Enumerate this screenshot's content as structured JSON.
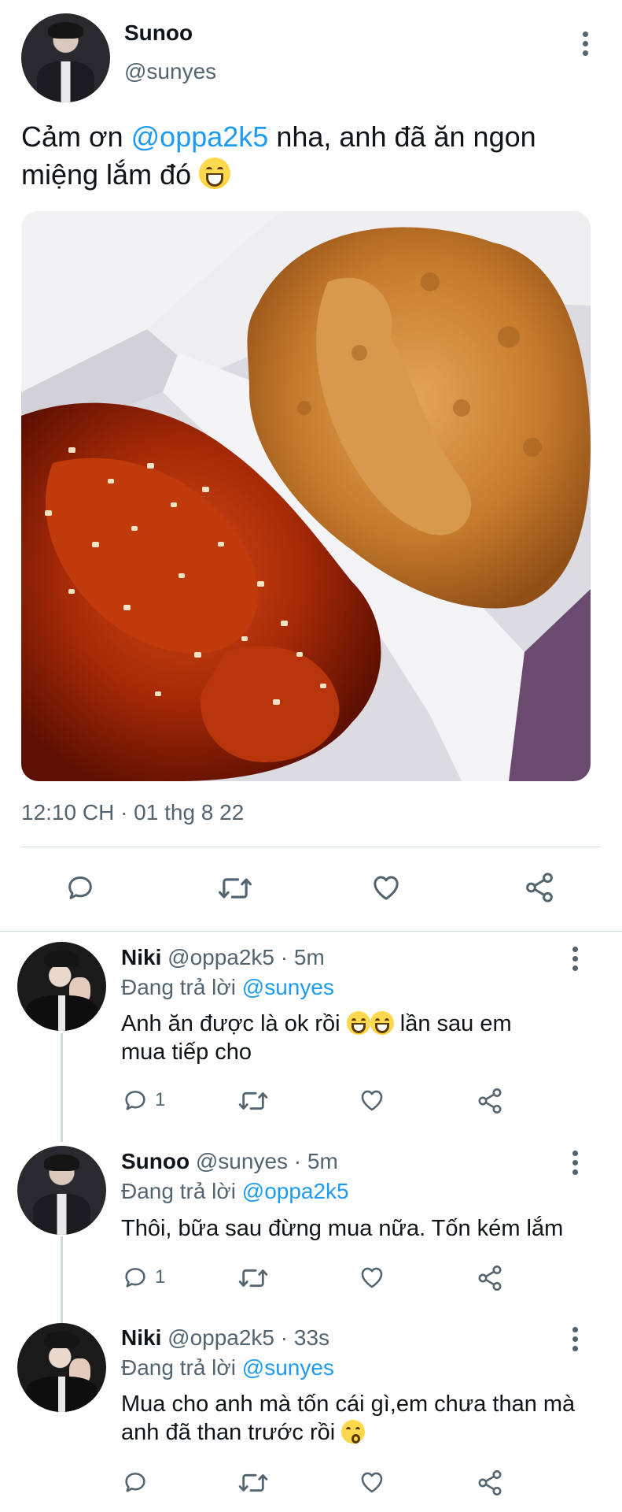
{
  "tweet": {
    "author_name": "Sunoo",
    "author_handle": "@sunyes",
    "text_before": "Cảm ơn ",
    "mention": "@oppa2k5",
    "text_after": " nha, anh đã ăn ngon miệng lắm đó",
    "emoji": "grinning-face",
    "image_alt": "fried chicken",
    "timestamp": "12:10 CH · 01 thg 8 22",
    "actions": [
      "reply-icon",
      "retweet-icon",
      "like-icon",
      "share-icon"
    ]
  },
  "replies": [
    {
      "name": "Niki",
      "handle": "@oppa2k5",
      "time": " · 5m",
      "replying_label": "Đang trả lời ",
      "replying_to": "@sunyes",
      "text_before": "Anh ăn được là ok rồi ",
      "text_after": " lần sau em mua tiếp cho",
      "reply_count": "1"
    },
    {
      "name": "Sunoo",
      "handle": "@sunyes",
      "time": " · 5m",
      "replying_label": "Đang trả lời ",
      "replying_to": "@oppa2k5",
      "text": "Thôi, bữa sau đừng mua nữa. Tốn kém lắm",
      "reply_count": "1"
    },
    {
      "name": "Niki",
      "handle": "@oppa2k5",
      "time": " · 33s",
      "replying_label": "Đang trả lời ",
      "replying_to": "@sunyes",
      "text_before": "Mua cho anh mà tốn cái gì,em chưa than mà anh đã than trước rồi ",
      "reply_count": ""
    }
  ],
  "colors": {
    "accent": "#1d9bf0",
    "muted": "#536471",
    "divider": "#cfd9de"
  }
}
